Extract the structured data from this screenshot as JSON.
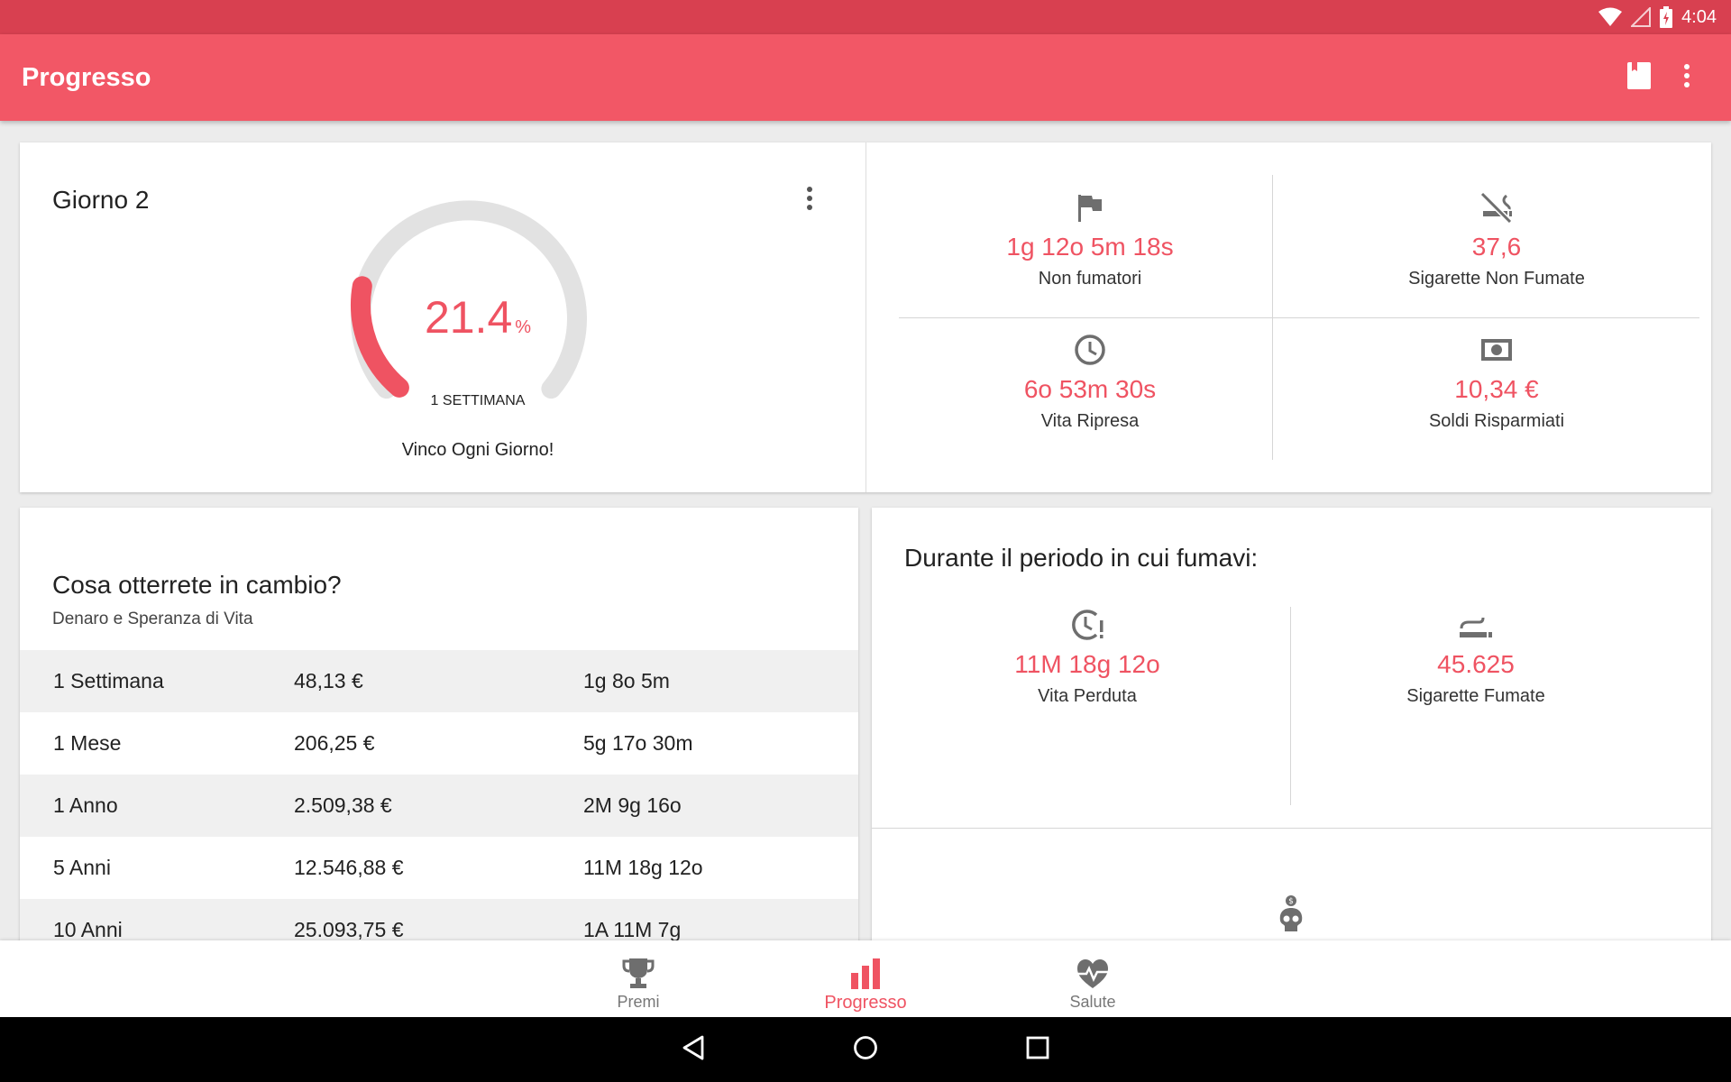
{
  "status_bar": {
    "time": "4:04"
  },
  "app_bar": {
    "title": "Progresso",
    "actions": [
      "book-icon",
      "more-vert-icon"
    ]
  },
  "progress_card": {
    "title": "Giorno 2",
    "gauge": {
      "value": "21.4",
      "unit": "%",
      "fraction": 0.214,
      "target": "1 SETTIMANA"
    },
    "caption": "Vinco Ogni Giorno!",
    "stats": [
      {
        "icon": "flag-icon",
        "value": "1g 12o 5m 18s",
        "label": "Non fumatori"
      },
      {
        "icon": "no-smoking-icon",
        "value": "37,6",
        "label": "Sigarette Non Fumate"
      },
      {
        "icon": "clock-icon",
        "value": "6o 53m 30s",
        "label": "Vita Ripresa"
      },
      {
        "icon": "money-icon",
        "value": "10,34 €",
        "label": "Soldi Risparmiati"
      }
    ]
  },
  "rewards_card": {
    "title": "Cosa otterrete in cambio?",
    "subtitle": "Denaro e Speranza di Vita",
    "rows": [
      {
        "period": "1 Settimana",
        "money": "48,13 €",
        "life": "1g 8o 5m"
      },
      {
        "period": "1 Mese",
        "money": "206,25 €",
        "life": "5g 17o 30m"
      },
      {
        "period": "1 Anno",
        "money": "2.509,38 €",
        "life": "2M 9g 16o"
      },
      {
        "period": "5 Anni",
        "money": "12.546,88 €",
        "life": "11M 18g 12o"
      },
      {
        "period": "10 Anni",
        "money": "25.093,75 €",
        "life": "1A 11M 7g"
      }
    ]
  },
  "smoking_card": {
    "title": "Durante il periodo in cui fumavi:",
    "stats": [
      {
        "icon": "clock-alert-icon",
        "value": "11M 18g 12o",
        "label": "Vita Perduta"
      },
      {
        "icon": "cigarette-icon",
        "value": "45.625",
        "label": "Sigarette Fumate"
      }
    ],
    "bottom_icon": "skull-money-icon"
  },
  "bottom_nav": {
    "items": [
      {
        "label": "Premi",
        "icon": "trophy-icon",
        "active": false
      },
      {
        "label": "Progresso",
        "icon": "bar-chart-icon",
        "active": true
      },
      {
        "label": "Salute",
        "icon": "heart-pulse-icon",
        "active": false
      }
    ]
  },
  "colors": {
    "status_bar": "#d84050",
    "app_bar": "#f25766",
    "accent": "#ef5362",
    "icon_gray": "#6e6e6e"
  }
}
